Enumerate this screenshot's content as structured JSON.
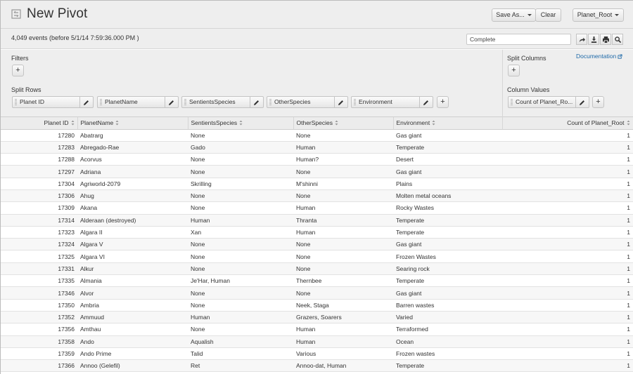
{
  "header": {
    "title": "New Pivot",
    "save_as_label": "Save As...",
    "clear_label": "Clear",
    "dataset_label": "Planet_Root"
  },
  "status": {
    "event_count": "4,049 events (before 5/1/14 7:59:36.000 PM )",
    "progress": "Complete"
  },
  "config": {
    "filters_label": "Filters",
    "split_rows_label": "Split Rows",
    "split_columns_label": "Split Columns",
    "column_values_label": "Column Values",
    "documentation_label": "Documentation",
    "split_rows": [
      "Planet ID",
      "PlanetName",
      "SentientsSpecies",
      "OtherSpecies",
      "Environment"
    ],
    "column_values": [
      "Count of Planet_Ro..."
    ]
  },
  "table": {
    "columns": [
      "Planet ID",
      "PlanetName",
      "SentientsSpecies",
      "OtherSpecies",
      "Environment",
      "Count of Planet_Root"
    ],
    "rows": [
      [
        "17280",
        "Abatrarg",
        "None",
        "None",
        "Gas giant",
        "1"
      ],
      [
        "17283",
        "Abregado-Rae",
        "Gado",
        "Human",
        "Temperate",
        "1"
      ],
      [
        "17288",
        "Acorvus",
        "None",
        "Human?",
        "Desert",
        "1"
      ],
      [
        "17297",
        "Adriana",
        "None",
        "None",
        "Gas giant",
        "1"
      ],
      [
        "17304",
        "Agriworld-2079",
        "Skrilling",
        "M'shinni",
        "Plains",
        "1"
      ],
      [
        "17306",
        "Ahug",
        "None",
        "None",
        "Molten metal oceans",
        "1"
      ],
      [
        "17309",
        "Akana",
        "None",
        "Human",
        "Rocky Wastes",
        "1"
      ],
      [
        "17314",
        "Alderaan (destroyed)",
        "Human",
        "Thranta",
        "Temperate",
        "1"
      ],
      [
        "17323",
        "Algara II",
        "Xan",
        "Human",
        "Temperate",
        "1"
      ],
      [
        "17324",
        "Algara V",
        "None",
        "None",
        "Gas giant",
        "1"
      ],
      [
        "17325",
        "Algara VI",
        "None",
        "None",
        "Frozen Wastes",
        "1"
      ],
      [
        "17331",
        "Alkur",
        "None",
        "None",
        "Searing rock",
        "1"
      ],
      [
        "17335",
        "Almania",
        "Je'Har, Human",
        "Thernbee",
        "Temperate",
        "1"
      ],
      [
        "17346",
        "Alvor",
        "None",
        "None",
        "Gas giant",
        "1"
      ],
      [
        "17350",
        "Ambria",
        "None",
        "Neek, Staga",
        "Barren wastes",
        "1"
      ],
      [
        "17352",
        "Ammuud",
        "Human",
        "Grazers, Soarers",
        "Varied",
        "1"
      ],
      [
        "17356",
        "Amthau",
        "None",
        "Human",
        "Terraformed",
        "1"
      ],
      [
        "17358",
        "Ando",
        "Aqualish",
        "Human",
        "Ocean",
        "1"
      ],
      [
        "17359",
        "Ando Prime",
        "Talid",
        "Various",
        "Frozen wastes",
        "1"
      ],
      [
        "17366",
        "Annoo (Gelefil)",
        "Ret",
        "Annoo-dat, Human",
        "Temperate",
        "1"
      ]
    ]
  }
}
